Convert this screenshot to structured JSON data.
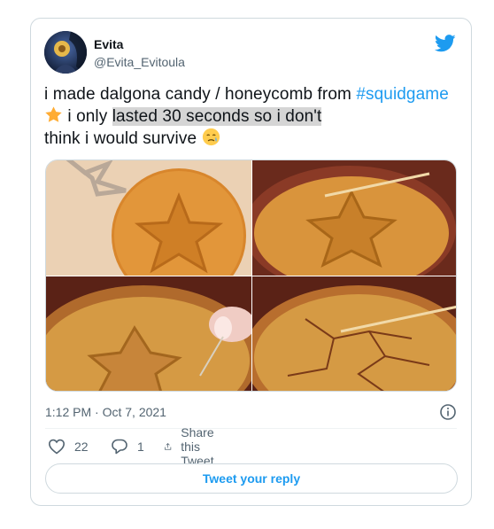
{
  "tweet": {
    "display_name": "Evita",
    "handle": "@Evita_Evitoula",
    "text_part1": "i made dalgona candy / honeycomb from ",
    "hashtag": "#squidgame",
    "text_part2": " i only ",
    "text_highlight": "lasted 30 seconds so i don't",
    "text_part3": "think i would survive",
    "timestamp": "1:12 PM · Oct 7, 2021",
    "like_count": "22",
    "reply_count": "1",
    "share_label": "Share this Tweet",
    "reply_button_label": "Tweet your reply"
  },
  "colors": {
    "accent": "#1d9bf0",
    "text": "#0f1419",
    "secondary": "#536471",
    "border": "#cfd9de"
  },
  "icons": [
    "twitter-bird-icon",
    "star-emoji-icon",
    "face-holding-back-tears-emoji-icon",
    "info-icon",
    "heart-icon",
    "reply-bubble-icon",
    "share-icon"
  ]
}
